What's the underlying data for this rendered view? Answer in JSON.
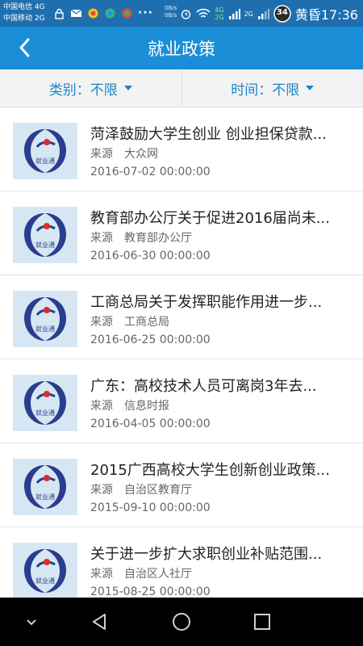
{
  "status_bar": {
    "carrier_1": "中国电信 4G",
    "carrier_2": "中国移动 2G",
    "speed_up": "0B/s",
    "speed_down": "0B/s",
    "net_1": "4G",
    "net_2": "2G",
    "net_3": "2G",
    "battery": "34",
    "time": "黄昏17:36"
  },
  "header": {
    "title": "就业政策"
  },
  "filters": {
    "category_label": "类别：不限",
    "time_label": "时间：不限"
  },
  "list": {
    "source_label": "来源",
    "items": [
      {
        "title": "菏泽鼓励大学生创业 创业担保贷款...",
        "source": "大众网",
        "date": "2016-07-02 00:00:00"
      },
      {
        "title": "教育部办公厅关于促进2016届尚未...",
        "source": "教育部办公厅",
        "date": "2016-06-30 00:00:00"
      },
      {
        "title": "工商总局关于发挥职能作用进一步...",
        "source": "工商总局",
        "date": "2016-06-25 00:00:00"
      },
      {
        "title": "广东：高校技术人员可离岗3年去...",
        "source": "信息时报",
        "date": "2016-04-05 00:00:00"
      },
      {
        "title": "2015广西高校大学生创新创业政策...",
        "source": "自治区教育厅",
        "date": "2015-09-10 00:00:00"
      },
      {
        "title": "关于进一步扩大求职创业补贴范围...",
        "source": "自治区人社厅",
        "date": "2015-08-25 00:00:00"
      }
    ],
    "logo_text": "就业通"
  },
  "colors": {
    "status_bar": "#1f6fae",
    "header": "#1a8ed6",
    "filter_text": "#1a86c9",
    "logo_blue": "#2a3e8f",
    "logo_red": "#e02a2a"
  }
}
